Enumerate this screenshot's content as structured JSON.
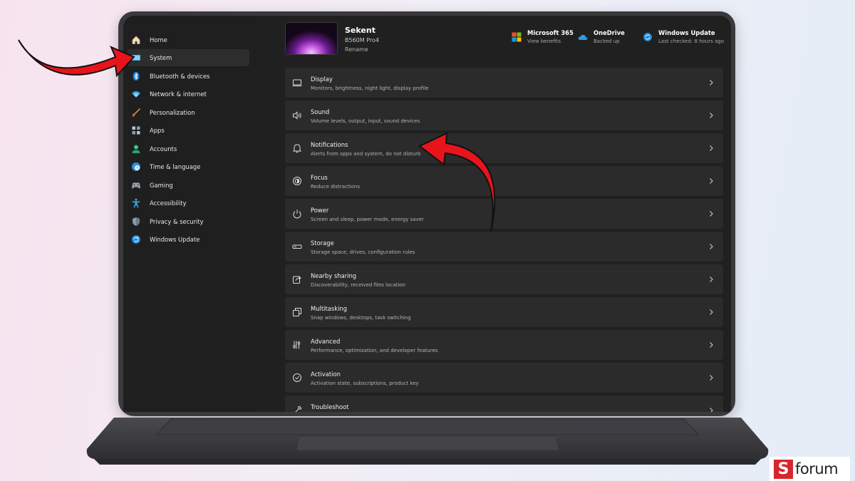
{
  "sidebar": {
    "items": [
      {
        "label": "Home",
        "icon": "home-icon"
      },
      {
        "label": "System",
        "icon": "system-icon",
        "selected": true
      },
      {
        "label": "Bluetooth & devices",
        "icon": "bluetooth-icon"
      },
      {
        "label": "Network & internet",
        "icon": "wifi-icon"
      },
      {
        "label": "Personalization",
        "icon": "brush-icon"
      },
      {
        "label": "Apps",
        "icon": "apps-icon"
      },
      {
        "label": "Accounts",
        "icon": "account-icon"
      },
      {
        "label": "Time & language",
        "icon": "globe-clock-icon"
      },
      {
        "label": "Gaming",
        "icon": "gamepad-icon"
      },
      {
        "label": "Accessibility",
        "icon": "accessibility-icon"
      },
      {
        "label": "Privacy & security",
        "icon": "shield-icon"
      },
      {
        "label": "Windows Update",
        "icon": "sync-icon"
      }
    ]
  },
  "device": {
    "name": "Sekent",
    "model": "B560M Pro4",
    "rename": "Rename"
  },
  "header": {
    "microsoft365": {
      "title": "Microsoft 365",
      "sub": "View benefits"
    },
    "onedrive": {
      "title": "OneDrive",
      "sub": "Backed up"
    },
    "windows_update": {
      "title": "Windows Update",
      "sub": "Last checked: 8 hours ago"
    }
  },
  "rows": [
    {
      "title": "Display",
      "sub": "Monitors, brightness, night light, display profile",
      "icon": "display-icon"
    },
    {
      "title": "Sound",
      "sub": "Volume levels, output, input, sound devices",
      "icon": "speaker-icon"
    },
    {
      "title": "Notifications",
      "sub": "Alerts from apps and system, do not disturb",
      "icon": "bell-icon"
    },
    {
      "title": "Focus",
      "sub": "Reduce distractions",
      "icon": "focus-icon"
    },
    {
      "title": "Power",
      "sub": "Screen and sleep, power mode, energy saver",
      "icon": "power-icon"
    },
    {
      "title": "Storage",
      "sub": "Storage space, drives, configuration rules",
      "icon": "storage-icon"
    },
    {
      "title": "Nearby sharing",
      "sub": "Discoverability, received files location",
      "icon": "share-icon"
    },
    {
      "title": "Multitasking",
      "sub": "Snap windows, desktops, task switching",
      "icon": "multitask-icon"
    },
    {
      "title": "Advanced",
      "sub": "Performance, optimization, and developer features",
      "icon": "advanced-icon"
    },
    {
      "title": "Activation",
      "sub": "Activation state, subscriptions, product key",
      "icon": "check-circle-icon"
    },
    {
      "title": "Troubleshoot",
      "sub": "",
      "icon": "wrench-icon"
    }
  ],
  "watermark": {
    "letter": "S",
    "text": "forum"
  },
  "colors": {
    "accent": "#60cdff",
    "annotation_arrow": "#e8141b",
    "logo_red": "#d7262d"
  }
}
